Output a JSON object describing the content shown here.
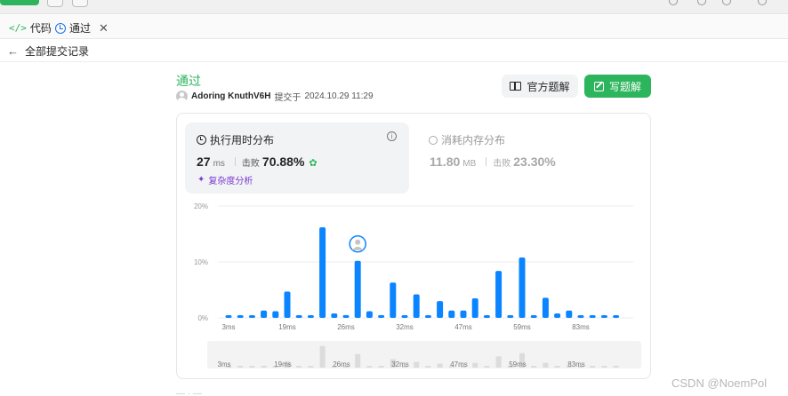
{
  "tabs": [
    {
      "label": "代码",
      "icon": "code-icon"
    },
    {
      "label": "通过",
      "icon": "history-icon"
    }
  ],
  "breadcrumb": {
    "label": "全部提交记录"
  },
  "submission": {
    "status": "通过",
    "user": "Adoring KnuthV6H",
    "submitted_text": "提交于",
    "timestamp": "2024.10.29 11:29"
  },
  "actions": {
    "solution_label": "官方题解",
    "write_label": "写题解"
  },
  "runtime": {
    "title": "执行用时分布",
    "value": "27",
    "unit": "ms",
    "beat_label": "击败",
    "beat_value": "70.88%",
    "complexity_label": "复杂度分析"
  },
  "memory": {
    "title": "消耗内存分布",
    "value": "11.80",
    "unit": "MB",
    "beat_label": "击败",
    "beat_value": "23.30%"
  },
  "watermark": "CSDN @NoemPol",
  "colors": {
    "accent": "#2db55d",
    "bar": "#0a84ff",
    "complexity": "#7a3bd1"
  },
  "chart_data": {
    "type": "bar",
    "y_ticks": [
      "20%",
      "10%",
      "0%"
    ],
    "ylim": [
      0,
      20
    ],
    "x_tick_labels": [
      "3ms",
      "19ms",
      "26ms",
      "32ms",
      "47ms",
      "59ms",
      "83ms"
    ],
    "x_tick_bar_index": [
      0,
      5,
      10,
      15,
      20,
      25,
      30
    ],
    "highlight_bar_index": 11,
    "values": [
      0.4,
      0.4,
      0.4,
      1.3,
      1.2,
      4.7,
      0.4,
      0.4,
      16.2,
      0.8,
      0.5,
      10.2,
      1.2,
      0.5,
      6.3,
      0.4,
      4.2,
      0.4,
      3.0,
      1.3,
      1.3,
      3.5,
      0.4,
      8.4,
      0.4,
      10.8,
      0.4,
      3.6,
      0.8,
      1.3,
      0.4,
      0.4,
      0.4,
      0.4
    ]
  }
}
